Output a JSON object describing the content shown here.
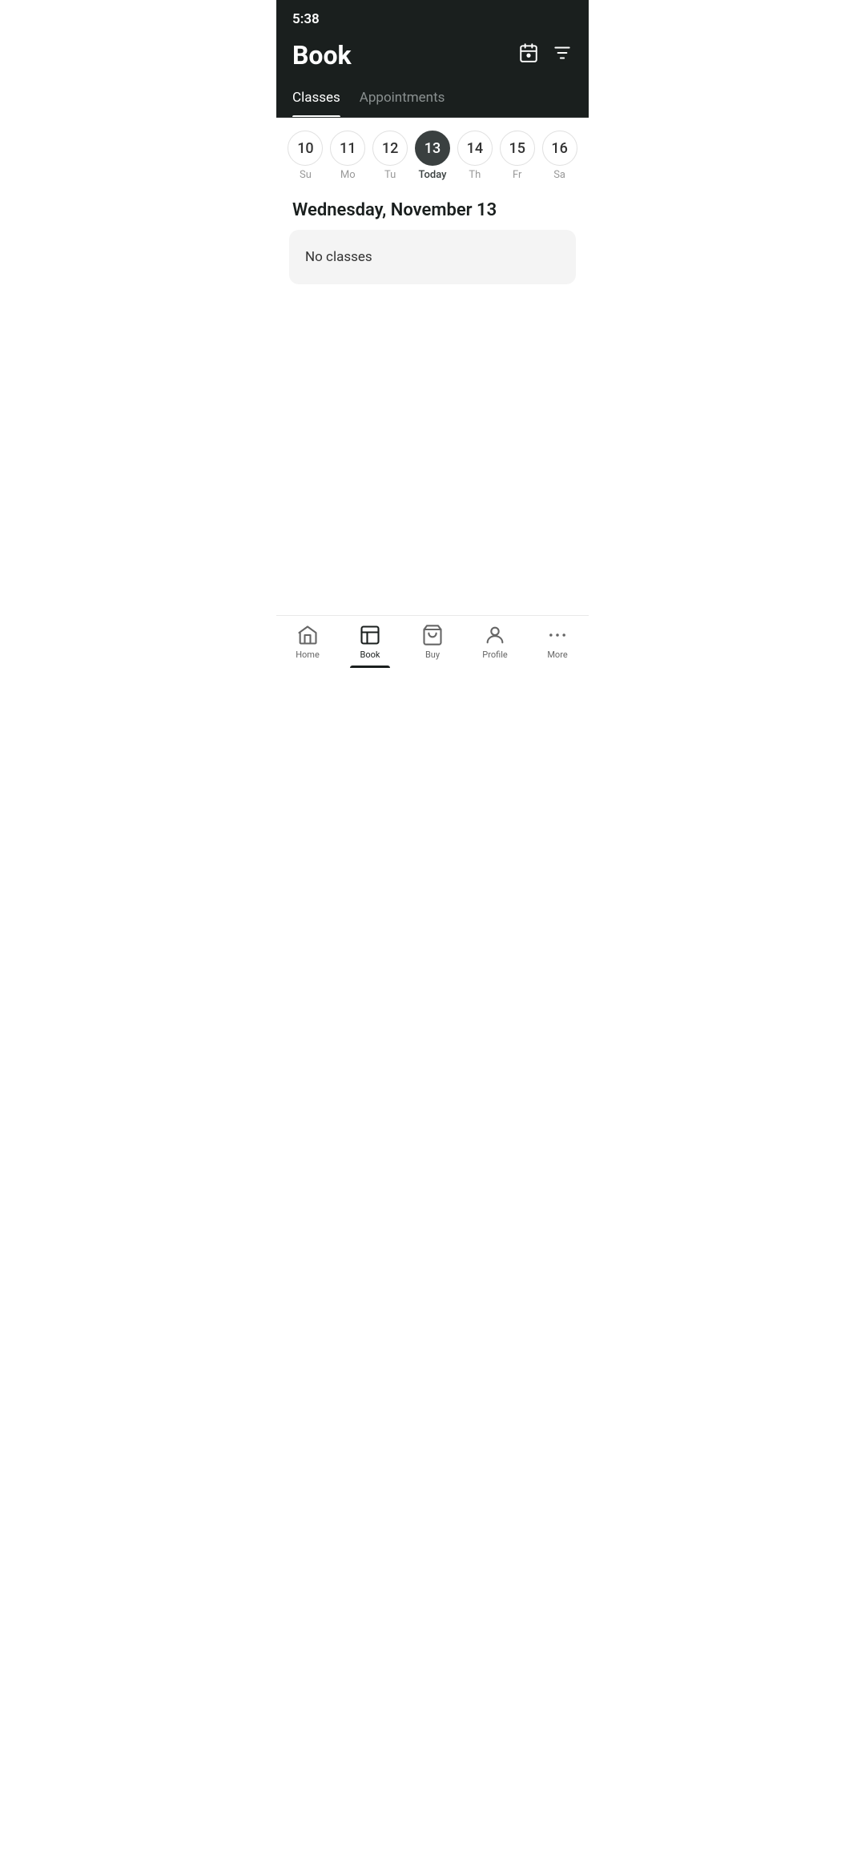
{
  "status_bar": {
    "time": "5:38"
  },
  "header": {
    "title": "Book",
    "calendar_icon": "calendar-icon",
    "filter_icon": "filter-icon"
  },
  "tabs": [
    {
      "label": "Classes",
      "active": true
    },
    {
      "label": "Appointments",
      "active": false
    }
  ],
  "calendar": {
    "days": [
      {
        "number": "10",
        "label": "Su",
        "is_today": false
      },
      {
        "number": "11",
        "label": "Mo",
        "is_today": false
      },
      {
        "number": "12",
        "label": "Tu",
        "is_today": false
      },
      {
        "number": "13",
        "label": "Today",
        "is_today": true
      },
      {
        "number": "14",
        "label": "Th",
        "is_today": false
      },
      {
        "number": "15",
        "label": "Fr",
        "is_today": false
      },
      {
        "number": "16",
        "label": "Sa",
        "is_today": false
      }
    ]
  },
  "selected_date": "Wednesday, November 13",
  "no_classes_message": "No classes",
  "bottom_nav": {
    "items": [
      {
        "label": "Home",
        "icon": "home-icon",
        "active": false
      },
      {
        "label": "Book",
        "icon": "book-icon",
        "active": true
      },
      {
        "label": "Buy",
        "icon": "buy-icon",
        "active": false
      },
      {
        "label": "Profile",
        "icon": "profile-icon",
        "active": false
      },
      {
        "label": "More",
        "icon": "more-icon",
        "active": false
      }
    ]
  }
}
